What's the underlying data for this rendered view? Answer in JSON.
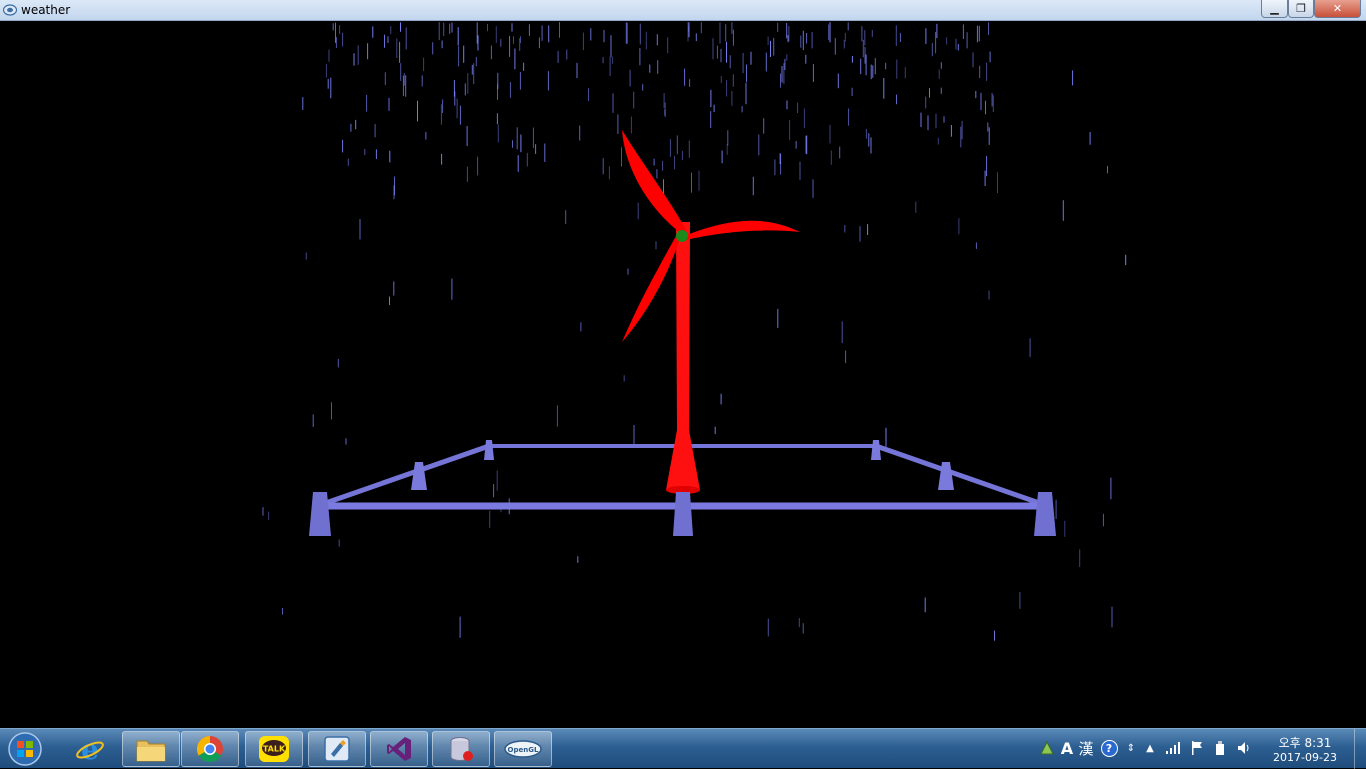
{
  "window": {
    "title": "weather",
    "minimize_label": "▁",
    "maximize_label": "❐",
    "close_label": "✕"
  },
  "scene": {
    "background": "#000000",
    "tower_color": "#ff0000",
    "blade_color": "#ff0000",
    "hub_color": "#1a8a1a",
    "platform_color": "#7575d8",
    "rain_color": "#7d86ff"
  },
  "taskbar": {
    "items": [
      {
        "name": "internet-explorer",
        "icon": "internet-explorer-icon"
      },
      {
        "name": "file-explorer",
        "icon": "folder-icon"
      },
      {
        "name": "chrome",
        "icon": "chrome-icon"
      },
      {
        "name": "kakaotalk",
        "icon": "kakaotalk-icon",
        "label": "TALK"
      },
      {
        "name": "tool-app",
        "icon": "tool-icon"
      },
      {
        "name": "visual-studio",
        "icon": "visual-studio-icon"
      },
      {
        "name": "database-app",
        "icon": "database-icon"
      },
      {
        "name": "opengl-app",
        "icon": "opengl-icon",
        "label": "OpenGL"
      }
    ]
  },
  "tray": {
    "ime_lang": "A",
    "ime_hanja": "漢",
    "help": "?",
    "time": "오후 8:31",
    "date": "2017-09-23"
  }
}
